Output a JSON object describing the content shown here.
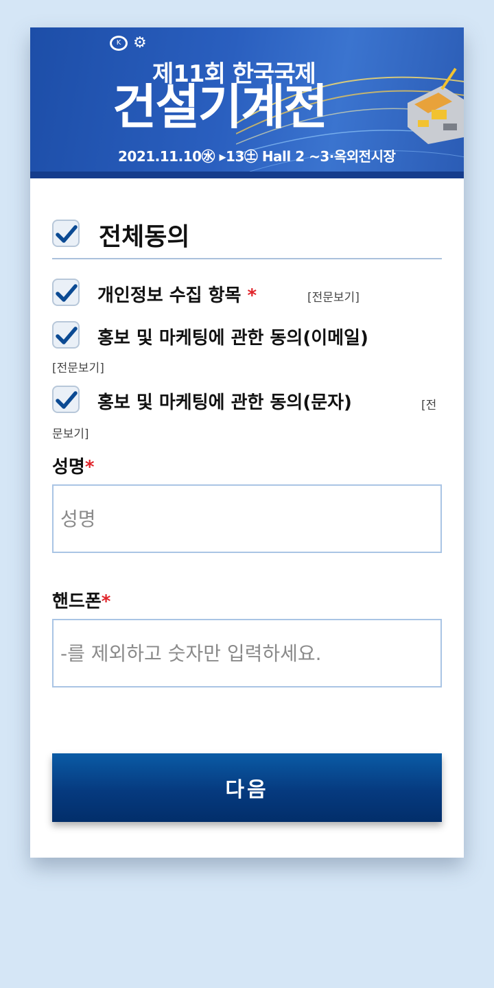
{
  "banner": {
    "logo_text": "",
    "edition": "제11회 한국국제",
    "title": "건설기계전",
    "dates": "2021.11.10㊌ ▸13㊏ Hall 2 ~3·옥외전시장"
  },
  "agree_all": {
    "label": "전체동의",
    "checked": true
  },
  "consents": [
    {
      "label": "개인정보 수집 항목",
      "required_mark": "*",
      "link": "[전문보기]",
      "checked": true
    },
    {
      "label": "홍보 및 마케팅에 관한 동의(이메일)",
      "link": "[전문보기]",
      "checked": true
    },
    {
      "label": "홍보 및 마케팅에 관한 동의(문자)",
      "link_part1": "[전",
      "link_part2": "문보기]",
      "checked": true
    }
  ],
  "name_field": {
    "label": "성명",
    "required_mark": "*",
    "placeholder": "성명",
    "value": ""
  },
  "phone_field": {
    "label": "핸드폰",
    "required_mark": "*",
    "placeholder": "-를 제외하고 숫자만 입력하세요.",
    "value": ""
  },
  "next_button": {
    "label": "다음"
  },
  "colors": {
    "banner": "#2a5fbf",
    "button": "#063a7f",
    "required": "#e0242a",
    "check": "#0b4a93",
    "page_bg": "#d5e6f6"
  }
}
